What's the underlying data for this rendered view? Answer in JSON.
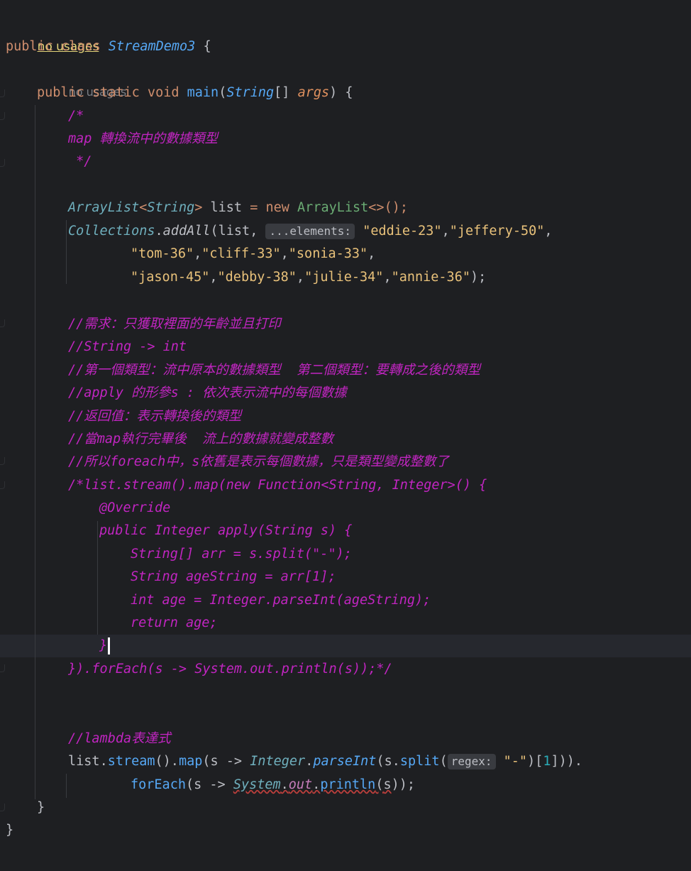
{
  "colors": {
    "background": "#1e1f22",
    "current_line": "#26282e",
    "keyword": "#cf8e6d",
    "class_name": "#56a8f5",
    "string": "#6aab73",
    "comment": "#c125c1",
    "usage_hint": "#7a7e85",
    "param_hint_bg": "#393b40"
  },
  "code": {
    "usages_top": "no usages",
    "class_kw": "public class ",
    "class_name": "StreamDemo3",
    "class_open": " {",
    "usages_main": "no usages",
    "main_kw": "public static void ",
    "main_name": "main",
    "main_paren_open": "(",
    "main_param_type": "String",
    "main_param_brackets": "[] ",
    "main_param_name": "args",
    "main_paren_close": ") {",
    "doc_open": "/*",
    "doc_body": "map 轉換流中的數據類型",
    "doc_close": " */",
    "list_type": "ArrayList",
    "list_generic_open": "<",
    "list_generic_type": "String",
    "list_generic_close": "> ",
    "list_var": "list",
    "list_eq": " = ",
    "list_new": "new ",
    "list_ctor": "ArrayList",
    "list_ctor_tail": "<>();",
    "collections": "Collections",
    "addall_dot": ".",
    "addall": "addAll",
    "addall_open": "(list, ",
    "hint_elements": "...elements:",
    "addall_args1": [
      "\"eddie-23\"",
      "\"jeffery-50\""
    ],
    "addall_args2": [
      "\"tom-36\"",
      "\"cliff-33\"",
      "\"sonia-33\""
    ],
    "addall_args3": [
      "\"jason-45\"",
      "\"debby-38\"",
      "\"julie-34\"",
      "\"annie-36\""
    ],
    "addall_close": ");",
    "comment_lines": [
      "//需求：只獲取裡面的年齡並且打印",
      "//String -> int",
      "//第一個類型：流中原本的數據類型  第二個類型：要轉成之後的類型",
      "//apply 的形參s : 依次表示流中的每個數據",
      "//返回值：表示轉換後的類型",
      "//當map執行完畢後  流上的數據就變成整數",
      "//所以foreach中，s依舊是表示每個數據，只是類型變成整數了"
    ],
    "block_comment_lines": [
      "/*list.stream().map(new Function<String, Integer>() {",
      "@Override",
      "public Integer apply(String s) {",
      "String[] arr = s.split(\"-\");",
      "String ageString = arr[1];",
      "int age = Integer.parseInt(ageString);",
      "return age;",
      "}",
      "}).forEach(s -> System.out.println(s));*/"
    ],
    "lambda_comment": "//lambda表達式",
    "lambda_line1": {
      "list": "list",
      "dot1": ".",
      "stream": "stream",
      "p1": "().",
      "map": "map",
      "p2": "(",
      "s": "s",
      "arrow": " -> ",
      "integer": "Integer",
      "dot2": ".",
      "parseint": "parseInt",
      "p3": "(",
      "s2": "s",
      "dot3": ".",
      "split": "split",
      "p4": "(",
      "hint_regex": "regex:",
      "dash": "\"-\"",
      "p5": ")[",
      "one": "1",
      "p6": "])).",
      "tail": ""
    },
    "lambda_line2": {
      "foreach": "forEach",
      "p1": "(",
      "s": "s",
      "arrow": " -> ",
      "system": "System",
      "dot1": ".",
      "out": "out",
      "dot2": ".",
      "println": "println",
      "p2": "(",
      "s2": "s",
      "p3": "));"
    },
    "main_close": "}",
    "class_close": "}"
  }
}
